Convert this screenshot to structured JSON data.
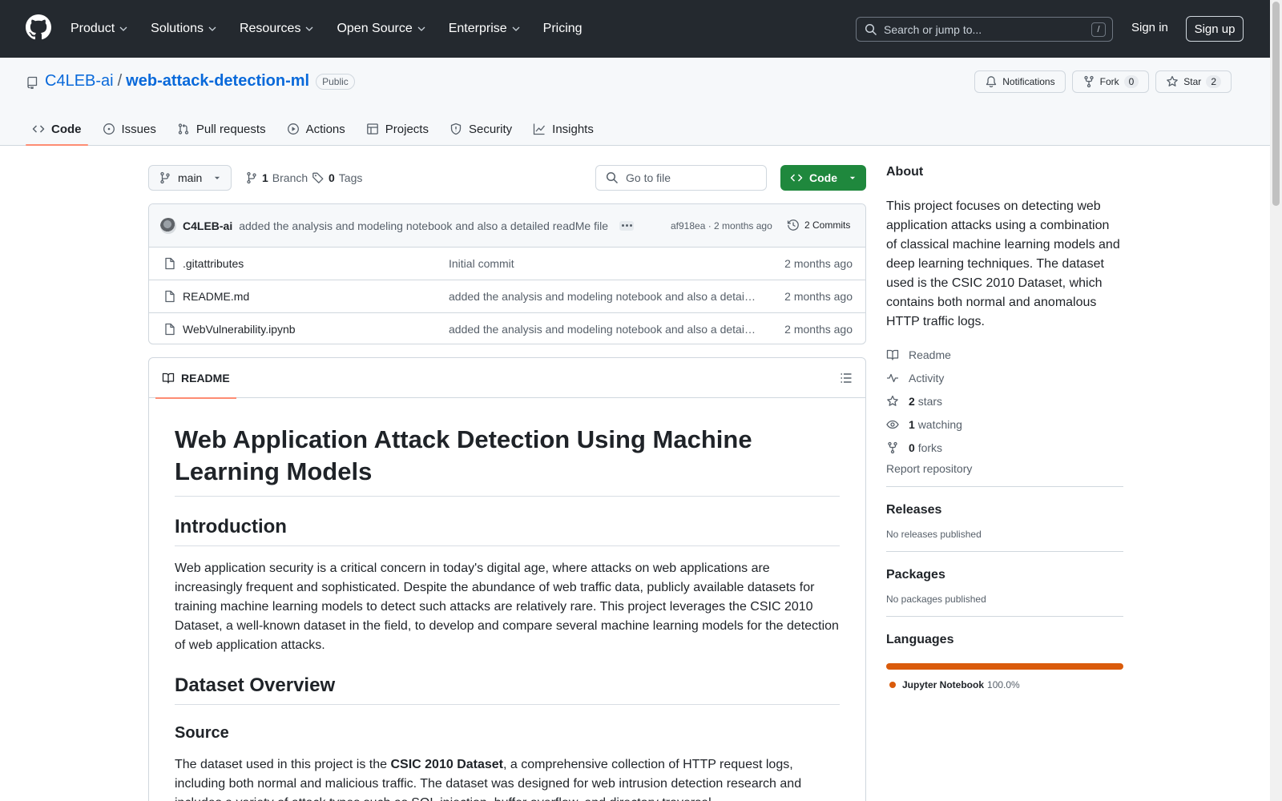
{
  "header": {
    "nav": [
      {
        "label": "Product",
        "dropdown": true
      },
      {
        "label": "Solutions",
        "dropdown": true
      },
      {
        "label": "Resources",
        "dropdown": true
      },
      {
        "label": "Open Source",
        "dropdown": true
      },
      {
        "label": "Enterprise",
        "dropdown": true
      },
      {
        "label": "Pricing",
        "dropdown": false
      }
    ],
    "search_placeholder": "Search or jump to...",
    "search_shortcut": "/",
    "sign_in": "Sign in",
    "sign_up": "Sign up"
  },
  "repo": {
    "owner": "C4LEB-ai",
    "separator": "/",
    "name": "web-attack-detection-ml",
    "visibility": "Public",
    "notifications_label": "Notifications",
    "fork_label": "Fork",
    "fork_count": "0",
    "star_label": "Star",
    "star_count": "2",
    "tabs": [
      {
        "label": "Code",
        "icon": "code-icon",
        "active": true
      },
      {
        "label": "Issues",
        "icon": "issue-icon",
        "active": false
      },
      {
        "label": "Pull requests",
        "icon": "pull-request-icon",
        "active": false
      },
      {
        "label": "Actions",
        "icon": "play-icon",
        "active": false
      },
      {
        "label": "Projects",
        "icon": "table-icon",
        "active": false
      },
      {
        "label": "Security",
        "icon": "shield-icon",
        "active": false
      },
      {
        "label": "Insights",
        "icon": "graph-icon",
        "active": false
      }
    ]
  },
  "toolbar": {
    "branch": "main",
    "branch_count": "1",
    "branch_label": "Branch",
    "tag_count": "0",
    "tag_label": "Tags",
    "goto_placeholder": "Go to file",
    "code_button": "Code"
  },
  "latest_commit": {
    "author": "C4LEB-ai",
    "message": "added the analysis and modeling notebook and also a detailed readMe file",
    "hash_time": "af918ea · 2 months ago",
    "commits_count": "2 Commits"
  },
  "files": [
    {
      "name": ".gitattributes",
      "message": "Initial commit",
      "time": "2 months ago"
    },
    {
      "name": "README.md",
      "message": "added the analysis and modeling notebook and also a detailed readMe file",
      "time": "2 months ago"
    },
    {
      "name": "WebVulnerability.ipynb",
      "message": "added the analysis and modeling notebook and also a detailed readMe file",
      "time": "2 months ago"
    }
  ],
  "readme": {
    "tab_label": "README",
    "title": "Web Application Attack Detection Using Machine Learning Models",
    "intro_heading": "Introduction",
    "intro_text": "Web application security is a critical concern in today's digital age, where attacks on web applications are increasingly frequent and sophisticated. Despite the abundance of web traffic data, publicly available datasets for training machine learning models to detect such attacks are relatively rare. This project leverages the CSIC 2010 Dataset, a well-known dataset in the field, to develop and compare several machine learning models for the detection of web application attacks.",
    "dataset_heading": "Dataset Overview",
    "source_heading": "Source",
    "source_text_1": "The dataset used in this project is the ",
    "source_bold": "CSIC 2010 Dataset",
    "source_text_2": ", a comprehensive collection of HTTP request logs, including both normal and malicious traffic. The dataset was designed for web intrusion detection research and includes a variety of attack types such as SQL injection, buffer overflow, and directory traversal."
  },
  "sidebar": {
    "about_title": "About",
    "description": "This project focuses on detecting web application attacks using a combination of classical machine learning models and deep learning techniques. The dataset used is the CSIC 2010 Dataset, which contains both normal and anomalous HTTP traffic logs.",
    "readme_link": "Readme",
    "activity_link": "Activity",
    "stars_count": "2",
    "stars_label": "stars",
    "watching_count": "1",
    "watching_label": "watching",
    "forks_count": "0",
    "forks_label": "forks",
    "report_link": "Report repository",
    "releases_title": "Releases",
    "releases_text": "No releases published",
    "packages_title": "Packages",
    "packages_text": "No packages published",
    "languages_title": "Languages",
    "language_name": "Jupyter Notebook",
    "language_pct": "100.0%",
    "language_color": "#da5b0b"
  },
  "colors": {
    "header_bg": "#24292f",
    "link": "#0969da",
    "code_button": "#1f883d",
    "active_tab_underline": "#fd8c73"
  }
}
